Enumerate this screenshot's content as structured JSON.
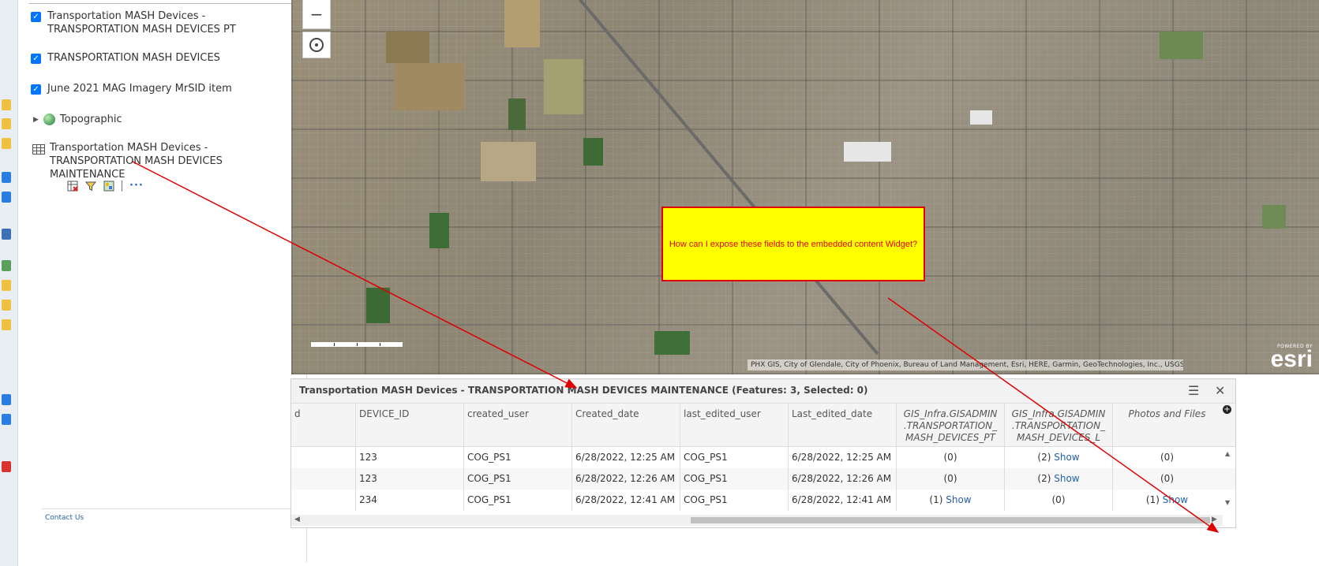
{
  "layers": [
    {
      "label_line1": "Transportation MASH Devices -",
      "label_line2": "TRANSPORTATION MASH DEVICES PT",
      "checked": true
    },
    {
      "label_line1": "TRANSPORTATION MASH DEVICES",
      "checked": true
    },
    {
      "label_line1": "June 2021 MAG Imagery MrSID item",
      "checked": true
    },
    {
      "label_line1": "Topographic",
      "icon": "globe-icon"
    },
    {
      "label_line1": "Transportation MASH Devices -",
      "label_line2": "TRANSPORTATION MASH DEVICES",
      "label_line3": "MAINTENANCE",
      "icon": "table-icon"
    }
  ],
  "layer_tools": [
    "table-remove-icon",
    "filter-icon",
    "symbology-icon",
    "more-icon"
  ],
  "more_label": "···",
  "footer": {
    "contact_label": "Contact Us"
  },
  "map": {
    "zoom_out_label": "−",
    "attribution": "PHX GIS, City of Glendale, City of Phoenix, Bureau of Land Management, Esri, HERE, Garmin, GeoTechnologies, Inc., USGS, ...",
    "logo_powered": "POWERED BY",
    "logo_brand": "esri"
  },
  "callout": {
    "text": "How can I expose these fields to the embedded content Widget?",
    "bg_color": "#ffff00",
    "text_color": "#e00000"
  },
  "table": {
    "title": "Transportation MASH Devices - TRANSPORTATION MASH DEVICES MAINTENANCE (Features: 3, Selected: 0)",
    "menu_icon": "☰",
    "close_icon": "✕",
    "add_column_label": "+",
    "columns": [
      {
        "h1": "d"
      },
      {
        "h1": "DEVICE_ID"
      },
      {
        "h1": "created_user"
      },
      {
        "h1": "Created_date"
      },
      {
        "h1": "last_edited_user"
      },
      {
        "h1": "Last_edited_date"
      },
      {
        "h1": "GIS_Infra.GISADMIN",
        "h2": ".TRANSPORTATION_",
        "h3": "MASH_DEVICES_PT"
      },
      {
        "h1": "GIS_Infra.GISADMIN",
        "h2": ".TRANSPORTATION_",
        "h3": "MASH_DEVICES_L"
      },
      {
        "h1": "Photos and Files"
      }
    ],
    "rows": [
      {
        "device_id": "123",
        "created_user": "COG_PS1",
        "created_date": "6/28/2022, 12:25 AM",
        "last_edited_user": "COG_PS1",
        "last_edited_date": "6/28/2022, 12:25 AM",
        "pt": "(0)",
        "pt_link": "",
        "l": "(2)",
        "l_link": "Show",
        "photos": "(0)",
        "photos_link": ""
      },
      {
        "device_id": "123",
        "created_user": "COG_PS1",
        "created_date": "6/28/2022, 12:26 AM",
        "last_edited_user": "COG_PS1",
        "last_edited_date": "6/28/2022, 12:26 AM",
        "pt": "(0)",
        "pt_link": "",
        "l": "(2)",
        "l_link": "Show",
        "photos": "(0)",
        "photos_link": ""
      },
      {
        "device_id": "234",
        "created_user": "COG_PS1",
        "created_date": "6/28/2022, 12:41 AM",
        "last_edited_user": "COG_PS1",
        "last_edited_date": "6/28/2022, 12:41 AM",
        "pt": "(1)",
        "pt_link": "Show",
        "l": "(0)",
        "l_link": "",
        "photos": "(1)",
        "photos_link": "Show"
      }
    ]
  },
  "annotation_color": "#e00000"
}
